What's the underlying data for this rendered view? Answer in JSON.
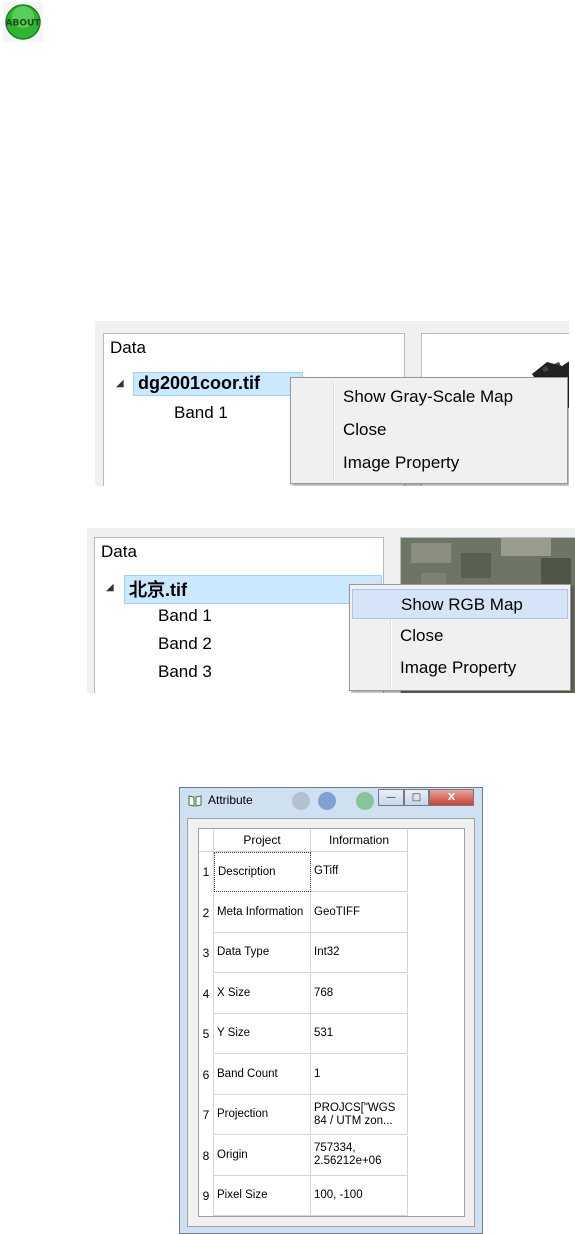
{
  "about_icon": {
    "label": "ABOUT",
    "color": "#2fb52f"
  },
  "gray_shot": {
    "panel_title": "Data",
    "file_name": "dg2001coor.tif",
    "bands": [
      "Band 1"
    ],
    "menu": [
      {
        "label": "Show Gray-Scale Map",
        "highlighted": false
      },
      {
        "label": "Close",
        "highlighted": false
      },
      {
        "label": "Image Property",
        "highlighted": false
      }
    ]
  },
  "rgb_shot": {
    "panel_title": "Data",
    "file_name": "北京.tif",
    "bands": [
      "Band 1",
      "Band 2",
      "Band 3"
    ],
    "menu": [
      {
        "label": "Show RGB Map",
        "highlighted": true
      },
      {
        "label": "Close",
        "highlighted": false
      },
      {
        "label": "Image Property",
        "highlighted": false
      }
    ]
  },
  "attribute_dialog": {
    "title": "Attribute",
    "window_buttons": {
      "minimize": "—",
      "maximize": "□",
      "close": "X"
    },
    "columns": [
      "Project",
      "Information"
    ],
    "rows": [
      {
        "num": "1",
        "project": "Description",
        "info": "GTiff"
      },
      {
        "num": "2",
        "project": "Meta Information",
        "info": "GeoTIFF"
      },
      {
        "num": "3",
        "project": "Data Type",
        "info": "Int32"
      },
      {
        "num": "4",
        "project": "X Size",
        "info": "768"
      },
      {
        "num": "5",
        "project": "Y Size",
        "info": "531"
      },
      {
        "num": "6",
        "project": "Band Count",
        "info": "1"
      },
      {
        "num": "7",
        "project": "Projection",
        "info": "PROJCS[\"WGS 84 / UTM zon..."
      },
      {
        "num": "8",
        "project": "Origin",
        "info": "757334, 2.56212e+06"
      },
      {
        "num": "9",
        "project": "Pixel Size",
        "info": "100, -100"
      }
    ]
  }
}
